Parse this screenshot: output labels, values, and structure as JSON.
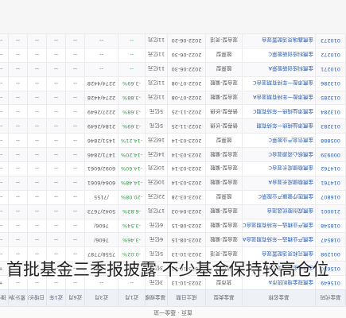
{
  "crumb": "首页 · 基金一览",
  "headers": [
    "基金代码",
    "基金名称",
    "基金类型",
    "成立日期",
    "基金规模",
    "近1月",
    "近3月",
    "近6月",
    "近1年",
    "日增长率",
    "累计净值",
    "操作"
  ],
  "rows": [
    [
      "015649",
      "金鹰现金增利货币A",
      "货币型",
      "2023-10-13",
      "3亿元",
      "--",
      "--",
      "--",
      "--",
      "--",
      "--",
      "+"
    ],
    [
      "015650",
      "金鹰现金增利货币B",
      "货币型",
      "2023-10-13",
      "3亿元",
      "--",
      "--",
      "--",
      "--",
      "--",
      "--",
      "+"
    ],
    [
      "001298",
      "金鹰元和灵活配置混合",
      "混合型-灵活",
      "2023-10-13",
      "5亿元",
      "-0.02%",
      "7558/7787",
      "--",
      "--",
      "--",
      "--",
      "--"
    ],
    [
      "018547",
      "金鹰产业精选一年持有期混合A",
      "混合型-偏股",
      "2023-08-15",
      "6亿元",
      "-3.46%",
      "7606/",
      "--",
      "--",
      "--",
      "--",
      "--"
    ],
    [
      "018548",
      "金鹰产业精选一年持有期混合C",
      "混合型-偏股",
      "2023-08-15",
      "6亿元",
      "-3.54%",
      "7606/",
      "--",
      "--",
      "--",
      "--",
      "--"
    ],
    [
      "210001",
      "金鹰成份股优选混合",
      "混合型-偏股",
      "2023-04-03",
      "17亿元",
      "-6.83%",
      "5042/7673",
      "--",
      "--",
      "--",
      "--",
      "--"
    ],
    [
      "016807",
      "金鹰医疗健康产业股票C",
      "股票型",
      "2023-03-28",
      "22亿元",
      "-20.08%",
      "/7155",
      "--",
      "--",
      "--",
      "--",
      "--"
    ],
    [
      "014761",
      "金鹰稳健成长混合A",
      "混合型-偏股",
      "2023-03-14",
      "10亿元",
      "-14.48%",
      "6064/6061",
      "--",
      "--",
      "--",
      "--",
      "--"
    ],
    [
      "014762",
      "金鹰稳健成长混合C",
      "混合型-偏股",
      "2023-03-14",
      "10亿元",
      "-14.60%",
      "6092/6061",
      "--",
      "--",
      "--",
      "--",
      "--"
    ],
    [
      "000939",
      "金鹰核心资源混合C",
      "混合型-偏股",
      "2023-03-14",
      "14亿元",
      "-14.20%",
      "1471/2846",
      "--",
      "--",
      "--",
      "--",
      "--"
    ],
    [
      "005888",
      "金鹰信息产业股票C",
      "股票型",
      "2023-03-14",
      "16亿元",
      "-14.21%",
      "1451/2846",
      "--",
      "--",
      "--",
      "--",
      "--"
    ],
    [
      "013283",
      "金鹰添益纯债一年持有期",
      "债券型-长债",
      "2022-11-25",
      "5亿元",
      "-3.69%",
      "2184/2649",
      "--",
      "--",
      "--",
      "--",
      "--"
    ],
    [
      "013284",
      "金鹰添益纯债一年持有期C",
      "债券型-长债",
      "2022-11-25",
      "5亿元",
      "-3.68%",
      "2227/2649",
      "--",
      "--",
      "--",
      "--",
      "--"
    ],
    [
      "013285",
      "金鹰添盈一年持有期混合A",
      "混合型-偏股",
      "2022-07-08",
      "11亿元",
      "-3.88%",
      "2274/4428",
      "--",
      "--",
      "--",
      "--",
      "--"
    ],
    [
      "013286",
      "金鹰添盈一年持有期混合C",
      "混合型-偏股",
      "2022-07-08",
      "11亿元",
      "-3.69%",
      "2274/4428",
      "--",
      "--",
      "--",
      "--",
      "--"
    ],
    [
      "010271",
      "金鹰科技创新股票A",
      "股票型",
      "2022-06-30",
      "11亿元",
      "--",
      "--",
      "--",
      "--",
      "--",
      "--",
      "--"
    ],
    [
      "010272",
      "金鹰科技创新股票C",
      "股票型",
      "2022-06-30",
      "11亿元",
      "--",
      "--",
      "--",
      "--",
      "--",
      "--",
      "--"
    ],
    [
      "010273",
      "金鹰鑫瑞灵活配置混合",
      "混合型-灵活",
      "2022-06-20",
      "11亿元",
      "--",
      "--",
      "--",
      "--",
      "--",
      "--",
      "--"
    ]
  ],
  "caption": "首批基金三季报披露 不少基金保持较高仓位"
}
